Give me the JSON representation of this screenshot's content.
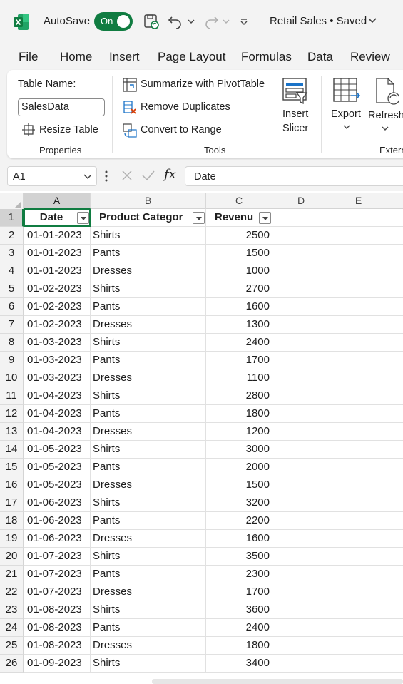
{
  "titlebar": {
    "autosave_label": "AutoSave",
    "toggle_label": "On",
    "document_title": "Retail Sales • Saved"
  },
  "menu": {
    "tabs": [
      "File",
      "Home",
      "Insert",
      "Page Layout",
      "Formulas",
      "Data",
      "Review"
    ]
  },
  "ribbon": {
    "table_name_label": "Table Name:",
    "table_name_value": "SalesData",
    "resize_table": "Resize Table",
    "properties_group": "Properties",
    "summarize_pivot": "Summarize with PivotTable",
    "remove_duplicates": "Remove Duplicates",
    "convert_to_range": "Convert to Range",
    "tools_group": "Tools",
    "insert_slicer_line1": "Insert",
    "insert_slicer_line2": "Slicer",
    "export": "Export",
    "refresh": "Refresh",
    "external_group": "Extern"
  },
  "formula_bar": {
    "name_box": "A1",
    "fx": "fx",
    "formula_value": "Date"
  },
  "colors": {
    "accent": "#107c41"
  },
  "grid": {
    "columns": [
      "A",
      "B",
      "C",
      "D",
      "E"
    ],
    "header_row": {
      "row_num": "1",
      "date": "Date",
      "category": "Product Categor",
      "revenue": "Revenu"
    },
    "rows": [
      {
        "n": "2",
        "date": "01-01-2023",
        "cat": "Shirts",
        "rev": "2500"
      },
      {
        "n": "3",
        "date": "01-01-2023",
        "cat": "Pants",
        "rev": "1500"
      },
      {
        "n": "4",
        "date": "01-01-2023",
        "cat": "Dresses",
        "rev": "1000"
      },
      {
        "n": "5",
        "date": "01-02-2023",
        "cat": "Shirts",
        "rev": "2700"
      },
      {
        "n": "6",
        "date": "01-02-2023",
        "cat": "Pants",
        "rev": "1600"
      },
      {
        "n": "7",
        "date": "01-02-2023",
        "cat": "Dresses",
        "rev": "1300"
      },
      {
        "n": "8",
        "date": "01-03-2023",
        "cat": "Shirts",
        "rev": "2400"
      },
      {
        "n": "9",
        "date": "01-03-2023",
        "cat": "Pants",
        "rev": "1700"
      },
      {
        "n": "10",
        "date": "01-03-2023",
        "cat": "Dresses",
        "rev": "1100"
      },
      {
        "n": "11",
        "date": "01-04-2023",
        "cat": "Shirts",
        "rev": "2800"
      },
      {
        "n": "12",
        "date": "01-04-2023",
        "cat": "Pants",
        "rev": "1800"
      },
      {
        "n": "13",
        "date": "01-04-2023",
        "cat": "Dresses",
        "rev": "1200"
      },
      {
        "n": "14",
        "date": "01-05-2023",
        "cat": "Shirts",
        "rev": "3000"
      },
      {
        "n": "15",
        "date": "01-05-2023",
        "cat": "Pants",
        "rev": "2000"
      },
      {
        "n": "16",
        "date": "01-05-2023",
        "cat": "Dresses",
        "rev": "1500"
      },
      {
        "n": "17",
        "date": "01-06-2023",
        "cat": "Shirts",
        "rev": "3200"
      },
      {
        "n": "18",
        "date": "01-06-2023",
        "cat": "Pants",
        "rev": "2200"
      },
      {
        "n": "19",
        "date": "01-06-2023",
        "cat": "Dresses",
        "rev": "1600"
      },
      {
        "n": "20",
        "date": "01-07-2023",
        "cat": "Shirts",
        "rev": "3500"
      },
      {
        "n": "21",
        "date": "01-07-2023",
        "cat": "Pants",
        "rev": "2300"
      },
      {
        "n": "22",
        "date": "01-07-2023",
        "cat": "Dresses",
        "rev": "1700"
      },
      {
        "n": "23",
        "date": "01-08-2023",
        "cat": "Shirts",
        "rev": "3600"
      },
      {
        "n": "24",
        "date": "01-08-2023",
        "cat": "Pants",
        "rev": "2400"
      },
      {
        "n": "25",
        "date": "01-08-2023",
        "cat": "Dresses",
        "rev": "1800"
      },
      {
        "n": "26",
        "date": "01-09-2023",
        "cat": "Shirts",
        "rev": "3400"
      }
    ]
  }
}
